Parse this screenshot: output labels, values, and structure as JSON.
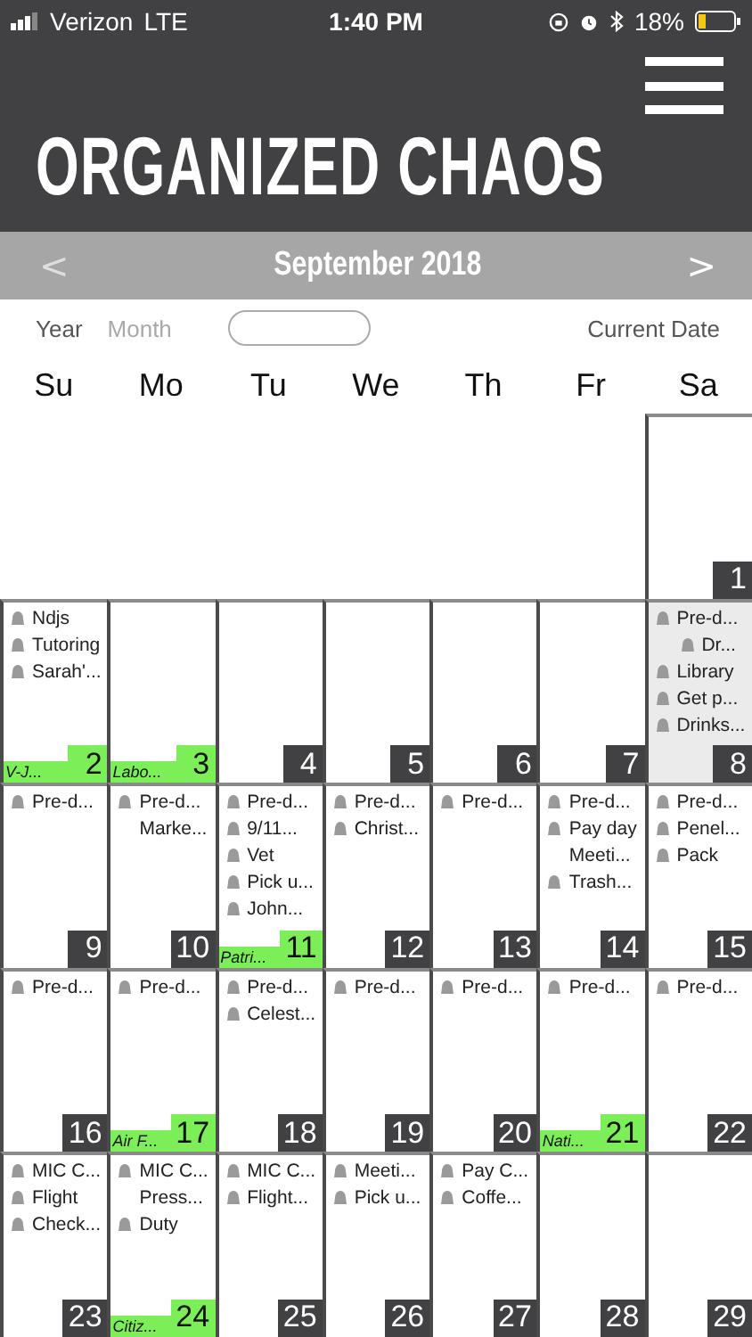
{
  "status_bar": {
    "carrier": "Verizon",
    "network": "LTE",
    "time": "1:40 PM",
    "battery": "18%"
  },
  "header": {
    "title": "ORGANIZED CHAOS"
  },
  "month_bar": {
    "prev": "<",
    "title": "September 2018",
    "next": ">",
    "prev_disabled": true
  },
  "view_tabs": [
    {
      "label": "Year",
      "selected": false
    },
    {
      "label": "Month",
      "selected": true
    }
  ],
  "current_date_button": "Current Date",
  "weekdays": [
    "Su",
    "Mo",
    "Tu",
    "We",
    "Th",
    "Fr",
    "Sa"
  ],
  "weeks": [
    {
      "days": [
        {
          "kind": "blank"
        },
        {
          "kind": "blank"
        },
        {
          "kind": "blank"
        },
        {
          "kind": "blank"
        },
        {
          "kind": "blank"
        },
        {
          "kind": "blank"
        },
        {
          "kind": "day",
          "number": "1",
          "selected": false
        }
      ]
    },
    {
      "days": [
        {
          "kind": "day",
          "number": "2",
          "selected": false,
          "holiday": "V-J...",
          "events": [
            {
              "text": "Ndjs",
              "icon": true
            },
            {
              "text": "Tutoring",
              "icon": true
            },
            {
              "text": "Sarah'...",
              "icon": true
            }
          ]
        },
        {
          "kind": "day",
          "number": "3",
          "selected": false,
          "holiday": "Labo..."
        },
        {
          "kind": "day",
          "number": "4",
          "selected": false
        },
        {
          "kind": "day",
          "number": "5",
          "selected": false
        },
        {
          "kind": "day",
          "number": "6",
          "selected": false
        },
        {
          "kind": "day",
          "number": "7",
          "selected": false
        },
        {
          "kind": "day",
          "number": "8",
          "selected": true,
          "events": [
            {
              "text": "Pre-d...",
              "icon": true
            },
            {
              "text": "Dr...",
              "icon": true,
              "indent": true
            },
            {
              "text": "Library",
              "icon": true
            },
            {
              "text": "Get p...",
              "icon": true
            },
            {
              "text": "Drinks...",
              "icon": true
            }
          ]
        }
      ]
    },
    {
      "days": [
        {
          "kind": "day",
          "number": "9",
          "selected": false,
          "events": [
            {
              "text": "Pre-d...",
              "icon": true
            }
          ]
        },
        {
          "kind": "day",
          "number": "10",
          "selected": false,
          "events": [
            {
              "text": "Pre-d...",
              "icon": true
            },
            {
              "text": "Marke...",
              "icon": false
            }
          ]
        },
        {
          "kind": "day",
          "number": "11",
          "selected": false,
          "holiday": "Patri...",
          "events": [
            {
              "text": "Pre-d...",
              "icon": true
            },
            {
              "text": "9/11...",
              "icon": true
            },
            {
              "text": "Vet",
              "icon": true
            },
            {
              "text": "Pick u...",
              "icon": true
            },
            {
              "text": "John...",
              "icon": true
            }
          ]
        },
        {
          "kind": "day",
          "number": "12",
          "selected": false,
          "events": [
            {
              "text": "Pre-d...",
              "icon": true
            },
            {
              "text": "Christ...",
              "icon": true
            }
          ]
        },
        {
          "kind": "day",
          "number": "13",
          "selected": false,
          "events": [
            {
              "text": "Pre-d...",
              "icon": true
            }
          ]
        },
        {
          "kind": "day",
          "number": "14",
          "selected": false,
          "events": [
            {
              "text": "Pre-d...",
              "icon": true
            },
            {
              "text": "Pay day",
              "icon": true
            },
            {
              "text": "Meeti...",
              "icon": false
            },
            {
              "text": "Trash...",
              "icon": true
            }
          ]
        },
        {
          "kind": "day",
          "number": "15",
          "selected": false,
          "events": [
            {
              "text": "Pre-d...",
              "icon": true
            },
            {
              "text": "Penel...",
              "icon": true
            },
            {
              "text": "Pack",
              "icon": true
            }
          ]
        }
      ]
    },
    {
      "days": [
        {
          "kind": "day",
          "number": "16",
          "selected": false,
          "events": [
            {
              "text": "Pre-d...",
              "icon": true
            }
          ]
        },
        {
          "kind": "day",
          "number": "17",
          "selected": false,
          "holiday": "Air F...",
          "events": [
            {
              "text": "Pre-d...",
              "icon": true
            }
          ]
        },
        {
          "kind": "day",
          "number": "18",
          "selected": false,
          "events": [
            {
              "text": "Pre-d...",
              "icon": true
            },
            {
              "text": "Celest...",
              "icon": true
            }
          ]
        },
        {
          "kind": "day",
          "number": "19",
          "selected": false,
          "events": [
            {
              "text": "Pre-d...",
              "icon": true
            }
          ]
        },
        {
          "kind": "day",
          "number": "20",
          "selected": false,
          "events": [
            {
              "text": "Pre-d...",
              "icon": true
            }
          ]
        },
        {
          "kind": "day",
          "number": "21",
          "selected": false,
          "holiday": "Nati...",
          "events": [
            {
              "text": "Pre-d...",
              "icon": true
            }
          ]
        },
        {
          "kind": "day",
          "number": "22",
          "selected": false,
          "events": [
            {
              "text": "Pre-d...",
              "icon": true
            }
          ]
        }
      ]
    },
    {
      "days": [
        {
          "kind": "day",
          "number": "23",
          "selected": false,
          "events": [
            {
              "text": "MIC C...",
              "icon": true
            },
            {
              "text": "Flight",
              "icon": true
            },
            {
              "text": "Check...",
              "icon": true
            }
          ]
        },
        {
          "kind": "day",
          "number": "24",
          "selected": false,
          "holiday": "Citiz...",
          "events": [
            {
              "text": "MIC C...",
              "icon": true
            },
            {
              "text": "Press...",
              "icon": false
            },
            {
              "text": "Duty",
              "icon": true
            }
          ]
        },
        {
          "kind": "day",
          "number": "25",
          "selected": false,
          "events": [
            {
              "text": "MIC C...",
              "icon": true
            },
            {
              "text": "Flight...",
              "icon": true
            }
          ]
        },
        {
          "kind": "day",
          "number": "26",
          "selected": false,
          "events": [
            {
              "text": "Meeti...",
              "icon": true
            },
            {
              "text": "Pick u...",
              "icon": true
            }
          ]
        },
        {
          "kind": "day",
          "number": "27",
          "selected": false,
          "events": [
            {
              "text": "Pay C...",
              "icon": true
            },
            {
              "text": "Coffe...",
              "icon": true
            }
          ]
        },
        {
          "kind": "day",
          "number": "28",
          "selected": false
        },
        {
          "kind": "day",
          "number": "29",
          "selected": false
        }
      ]
    }
  ]
}
